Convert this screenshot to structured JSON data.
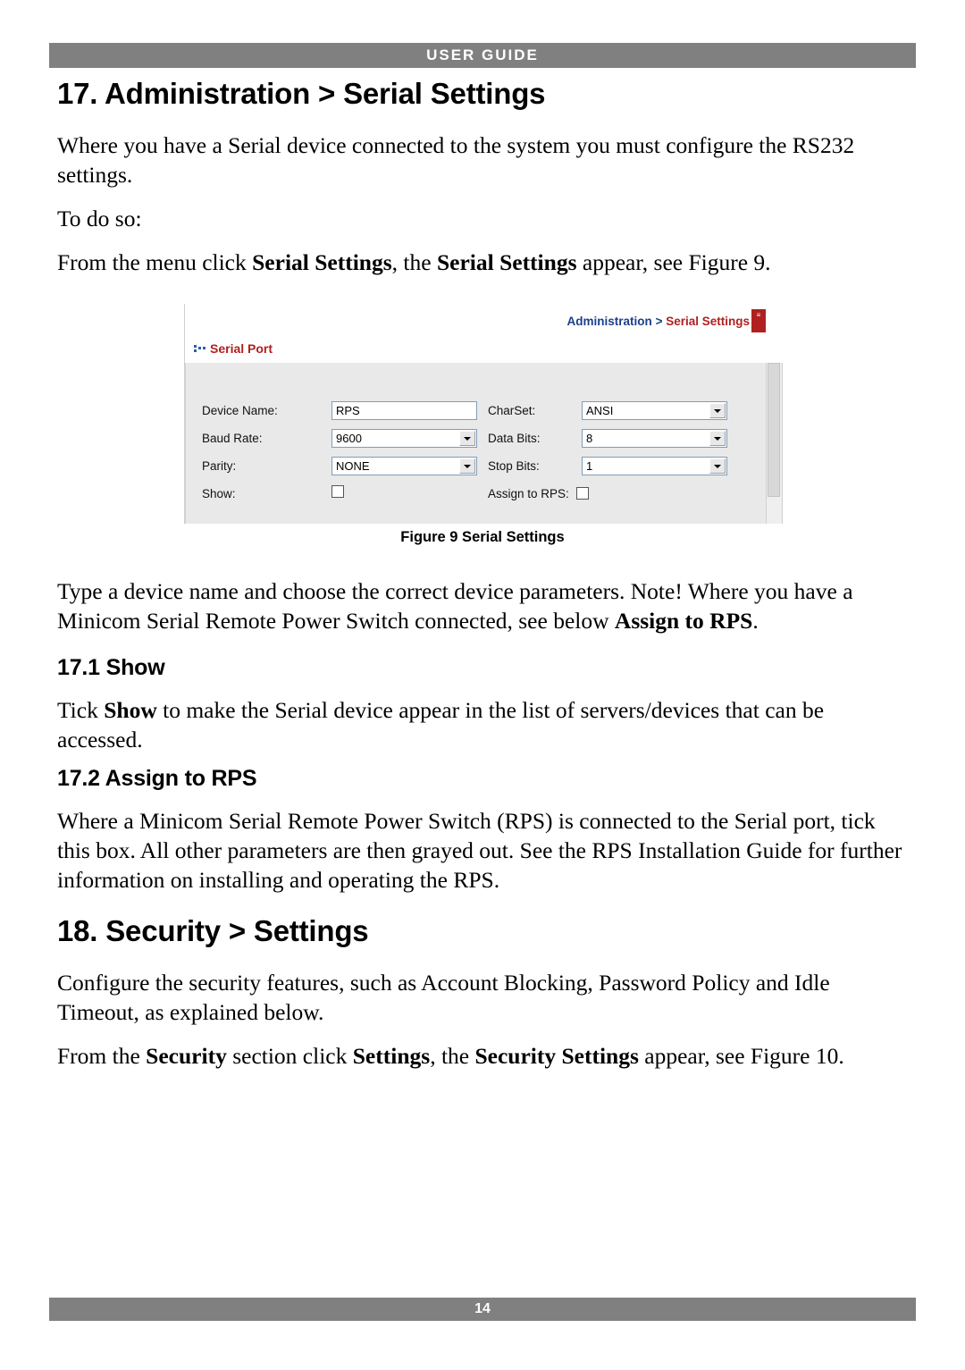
{
  "header": {
    "title": "USER GUIDE"
  },
  "footer": {
    "page_number": "14"
  },
  "chapter17": {
    "title": "17. Administration > Serial Settings",
    "intro": "Where you have a Serial device connected to the system you must configure the RS232 settings.",
    "todo": "To do so:",
    "from_menu_1": "From the menu click ",
    "from_menu_b1": "Serial Settings",
    "from_menu_2": ", the ",
    "from_menu_b2": "Serial Settings",
    "from_menu_3": " appear, see Figure 9.",
    "after_fig_1": "Type a device name and choose the correct device parameters. Note! Where you have a Minicom Serial Remote Power Switch connected, see below ",
    "after_fig_b1": "Assign to RPS",
    "after_fig_2": "."
  },
  "figure9": {
    "caption": "Figure 9 Serial Settings",
    "breadcrumb_first": "Administration",
    "breadcrumb_sep": " > ",
    "breadcrumb_last": "Serial Settings",
    "section_title": "Serial Port",
    "fields": {
      "device_name_label": "Device Name:",
      "device_name_value": "RPS",
      "charset_label": "CharSet:",
      "charset_value": "ANSI",
      "baud_rate_label": "Baud Rate:",
      "baud_rate_value": "9600",
      "data_bits_label": "Data Bits:",
      "data_bits_value": "8",
      "parity_label": "Parity:",
      "parity_value": "NONE",
      "stop_bits_label": "Stop Bits:",
      "stop_bits_value": "1",
      "show_label": "Show:",
      "assign_label": "Assign to RPS:"
    }
  },
  "section171": {
    "title": "17.1 Show",
    "text_1": "Tick ",
    "text_b1": "Show",
    "text_2": " to make the Serial device appear in the list of servers/devices that can be accessed."
  },
  "section172": {
    "title": "17.2 Assign to RPS",
    "text": "Where a Minicom Serial Remote Power Switch (RPS) is connected to the Serial port, tick this box. All other parameters are then grayed out. See the RPS Installation Guide for further information on installing and operating the RPS."
  },
  "chapter18": {
    "title": "18. Security > Settings",
    "intro": "Configure the security features, such as Account Blocking, Password Policy and Idle Timeout, as explained below.",
    "from_1": "From the ",
    "from_b1": "Security",
    "from_2": " section click ",
    "from_b2": "Settings",
    "from_3": ", the ",
    "from_b3": "Security Settings",
    "from_4": " appear, see Figure 10."
  }
}
